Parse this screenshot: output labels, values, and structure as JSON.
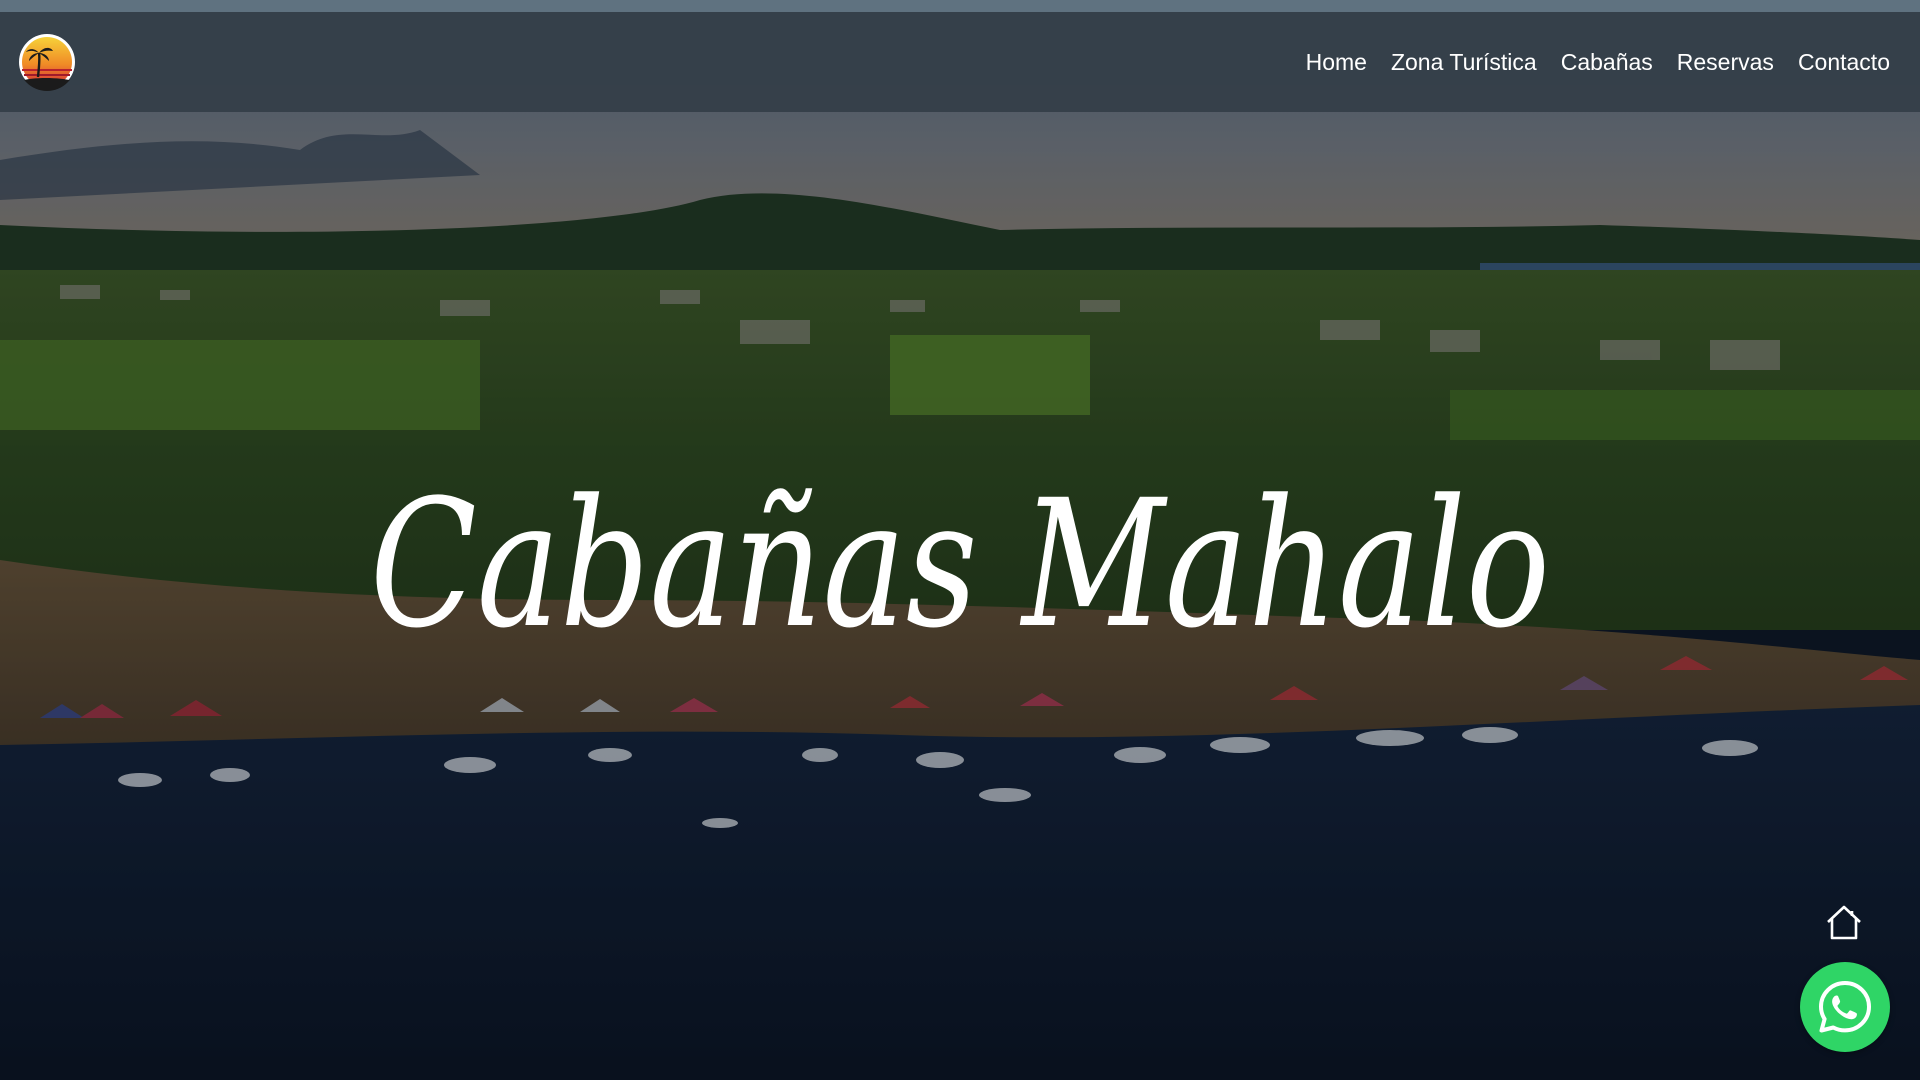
{
  "site": {
    "title": "Cabañas Mahalo"
  },
  "nav": {
    "logo_icon": "sunset-palm-logo",
    "items": [
      {
        "label": "Home"
      },
      {
        "label": "Zona Turística"
      },
      {
        "label": "Cabañas"
      },
      {
        "label": "Reservas"
      },
      {
        "label": "Contacto"
      }
    ]
  },
  "hero": {
    "background": "aerial photo of lakeside beach with boats, tents and houses",
    "title_color": "#ffffff"
  },
  "floating": {
    "home_icon": "home-icon",
    "whatsapp_icon": "whatsapp-icon",
    "whatsapp_color": "#2fd566"
  },
  "colors": {
    "navbar": "#343e48",
    "top_strip": "#5f7280"
  }
}
